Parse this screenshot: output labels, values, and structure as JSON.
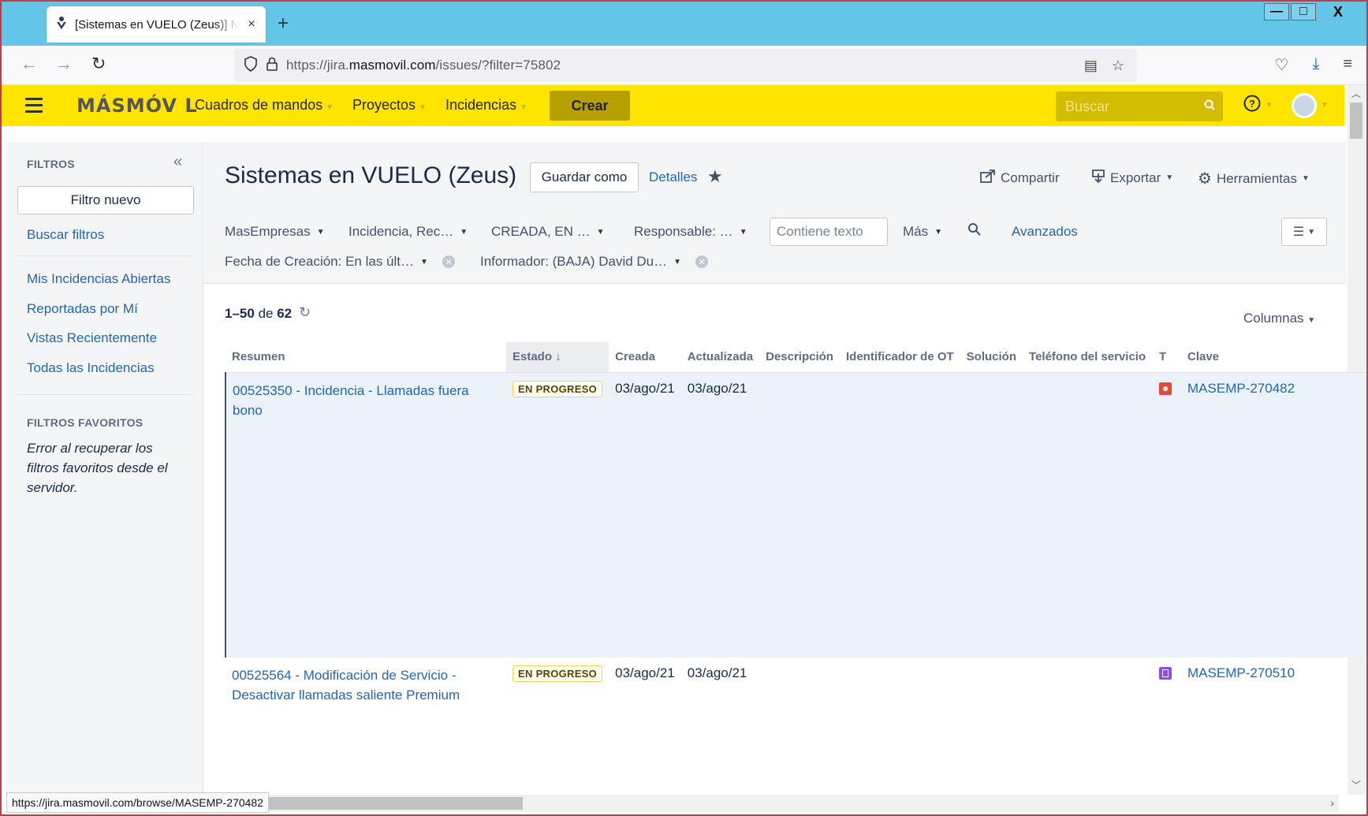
{
  "browser": {
    "tab_title": "[Sistemas en VUELO (Zeus)] Navegador de incidencias",
    "tab_close": "×",
    "new_tab": "+",
    "url_prefix": "https://jira.",
    "url_domain": "masmovil.com",
    "url_path": "/issues/?filter=75802",
    "status_url": "https://jira.masmovil.com/browse/MASEMP-270482",
    "window_controls": {
      "minimize": "—",
      "maximize": "□",
      "close": "X"
    }
  },
  "header": {
    "logo": "MÁSMÓV L",
    "nav": [
      {
        "label": "Cuadros de mandos"
      },
      {
        "label": "Proyectos"
      },
      {
        "label": "Incidencias"
      }
    ],
    "create_label": "Crear",
    "search_placeholder": "Buscar"
  },
  "sidebar": {
    "heading": "FILTROS",
    "new_filter": "Filtro nuevo",
    "search_filters": "Buscar filtros",
    "links": [
      "Mis Incidencias Abiertas",
      "Reportadas por Mí",
      "Vistas Recientemente",
      "Todas las Incidencias"
    ],
    "favorites_heading": "FILTROS FAVORITOS",
    "favorites_error": "Error al recuperar los filtros favoritos desde el servidor."
  },
  "main": {
    "title": "Sistemas en VUELO (Zeus)",
    "save_as": "Guardar como",
    "details": "Detalles",
    "share": "Compartir",
    "export": "Exportar",
    "tools": "Herramientas",
    "filters": {
      "project": "MasEmpresas",
      "type": "Incidencia, Rec…",
      "status": "CREADA, EN …",
      "assignee": "Responsable: …",
      "text_placeholder": "Contiene texto",
      "more": "Más",
      "advanced": "Avanzados",
      "created": "Fecha de Creación: En las últ…",
      "reporter": "Informador: (BAJA) David Du…"
    },
    "count_range": "1–50",
    "count_of": "de",
    "count_total": "62",
    "columns_label": "Columnas",
    "table": {
      "headers": {
        "summary": "Resumen",
        "status": "Estado",
        "created": "Creada",
        "updated": "Actualizada",
        "description": "Descripción",
        "ot_id": "Identificador de OT",
        "solution": "Solución",
        "phone": "Teléfono del servicio",
        "type": "T",
        "key": "Clave"
      },
      "rows": [
        {
          "summary": "00525350 - Incidencia - Llamadas fuera bono",
          "status": "EN PROGRESO",
          "created": "03/ago/21",
          "updated": "03/ago/21",
          "type_icon": "bug-icon",
          "key": "MASEMP-270482"
        },
        {
          "summary": "00525564 - Modificación de Servicio - Desactivar llamadas saliente Premium",
          "status": "EN PROGRESO",
          "created": "03/ago/21",
          "updated": "03/ago/21",
          "type_icon": "task-icon",
          "key": "MASEMP-270510"
        }
      ]
    }
  },
  "colors": {
    "header_bg": "#ffe400",
    "tabstrip_bg": "#63c6e8",
    "link": "#2566b0",
    "status_border": "#ffd351"
  }
}
